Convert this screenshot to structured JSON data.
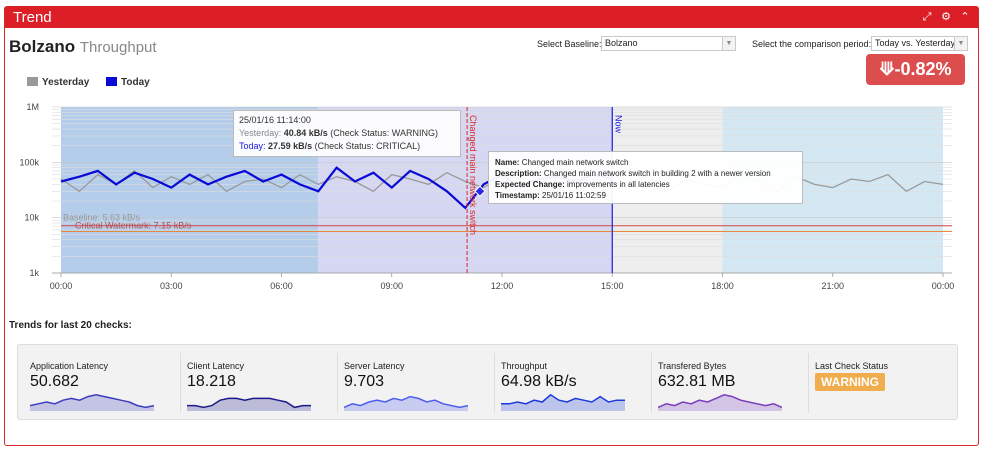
{
  "panel": {
    "title": "Trend"
  },
  "header_icons": [
    "expand-icon",
    "gear-icon",
    "collapse-icon"
  ],
  "page": {
    "title": "Bolzano",
    "subtitle": "Throughput"
  },
  "baseline": {
    "label": "Select Baseline:",
    "value": "Bolzano"
  },
  "comparison": {
    "label": "Select the comparison period:",
    "value": "Today vs. Yesterday"
  },
  "change_badge": {
    "text": "-0.82%",
    "icon": "arrow-down-icon",
    "color": "#dc4d4d"
  },
  "legend": [
    {
      "label": "Yesterday",
      "color": "#999999"
    },
    {
      "label": "Today",
      "color": "#0a0ad6"
    }
  ],
  "annotations": {
    "event_label": "Changed main network switch",
    "now_label": "Now",
    "baseline_label": "Baseline: 5.63 kB/s",
    "critical_label": "Critical Watermark: 7.15 kB/s"
  },
  "tooltip": {
    "time": "25/01/16 11:14:00",
    "yesterday_prefix": "Yesterday:",
    "yesterday_value": "40.84 kB/s",
    "yesterday_status": "(Check Status: WARNING)",
    "today_prefix": "Today:",
    "today_value": "27.59 kB/s",
    "today_status": "(Check Status: CRITICAL)"
  },
  "info_box": {
    "name_label": "Name:",
    "name": "Changed main network switch",
    "desc_label": "Description:",
    "desc": "Changed main network switch in building 2 with a newer version",
    "expected_label": "Expected Change:",
    "expected": "improvements in all latencies",
    "timestamp_label": "Timestamp:",
    "timestamp": "25/01/16 11:02:59"
  },
  "chart_data": {
    "type": "line",
    "yscale": "log",
    "yticks": [
      "1M",
      "100k",
      "10k",
      "1k"
    ],
    "xticks": [
      "00:00",
      "03:00",
      "06:00",
      "09:00",
      "12:00",
      "15:00",
      "18:00",
      "21:00",
      "00:00"
    ],
    "xlim_hours": [
      0,
      24
    ],
    "ylim_bytes_per_s": [
      1000,
      1000000
    ],
    "baseline_kBps": 5.63,
    "critical_watermark_kBps": 7.15,
    "event_hour": 11.0497,
    "now_hour": 15.0,
    "bands": [
      {
        "from_hour": 0,
        "to_hour": 7,
        "color": "#b4cdea"
      },
      {
        "from_hour": 7,
        "to_hour": 15,
        "color": "#d5d7f3"
      },
      {
        "from_hour": 15,
        "to_hour": 18,
        "color": "#eeeeee"
      },
      {
        "from_hour": 18,
        "to_hour": 24,
        "color": "#d3e8f3"
      }
    ],
    "series": [
      {
        "name": "Yesterday",
        "color": "#999999",
        "x": [
          0,
          0.5,
          1,
          1.5,
          2,
          2.5,
          3,
          3.5,
          4,
          4.5,
          5,
          5.5,
          6,
          6.5,
          7,
          7.5,
          8,
          8.5,
          9,
          9.5,
          10,
          10.5,
          11,
          11.5,
          12,
          12.5,
          13,
          13.5,
          14,
          14.5,
          15,
          15.5,
          16,
          16.5,
          17,
          17.5,
          18,
          18.5,
          19,
          19.5,
          20,
          20.5,
          21,
          21.5,
          22,
          22.5,
          23,
          23.5,
          24
        ],
        "y": [
          50,
          30,
          60,
          40,
          70,
          35,
          55,
          40,
          60,
          30,
          45,
          50,
          35,
          60,
          40,
          55,
          45,
          30,
          60,
          50,
          40,
          65,
          45,
          35,
          55,
          40,
          50,
          30,
          45,
          50,
          35,
          45,
          55,
          30,
          50,
          40,
          35,
          60,
          45,
          30,
          55,
          40,
          35,
          50,
          45,
          60,
          30,
          45,
          40
        ]
      },
      {
        "name": "Today",
        "color": "#0a0ad6",
        "x": [
          0,
          0.5,
          1,
          1.5,
          2,
          2.5,
          3,
          3.5,
          4,
          4.5,
          5,
          5.5,
          6,
          6.5,
          7,
          7.5,
          8,
          8.5,
          9,
          9.5,
          10,
          10.5,
          11,
          11.5,
          12,
          12.5,
          13,
          13.5,
          14,
          14.5,
          15
        ],
        "y": [
          45,
          55,
          70,
          40,
          65,
          50,
          35,
          60,
          40,
          55,
          70,
          45,
          60,
          40,
          30,
          80,
          45,
          65,
          35,
          70,
          50,
          30,
          15,
          40,
          60,
          35,
          50,
          55,
          45,
          60,
          50
        ]
      }
    ]
  },
  "trends_title": "Trends for last 20 checks:",
  "metrics": [
    {
      "label": "Application Latency",
      "value": "50.682",
      "color": "#3d3dbf",
      "spark": [
        3,
        4,
        5,
        4,
        6,
        7,
        6,
        8,
        9,
        8,
        7,
        6,
        5,
        3,
        2,
        3
      ]
    },
    {
      "label": "Client Latency",
      "value": "18.218",
      "color": "#1a1a8c",
      "spark": [
        3,
        3,
        2,
        3,
        6,
        7,
        7,
        6,
        7,
        7,
        7,
        6,
        5,
        2,
        3,
        3
      ]
    },
    {
      "label": "Server Latency",
      "value": "9.703",
      "color": "#4d5df0",
      "spark": [
        2,
        4,
        3,
        5,
        6,
        5,
        7,
        6,
        8,
        7,
        5,
        6,
        4,
        3,
        2,
        3
      ]
    },
    {
      "label": "Throughput",
      "value": "64.98 kB/s",
      "color": "#1a3adb",
      "spark": [
        4,
        4,
        5,
        4,
        6,
        5,
        9,
        6,
        5,
        7,
        6,
        5,
        8,
        5,
        6,
        6
      ]
    },
    {
      "label": "Transfered Bytes",
      "value": "632.81 MB",
      "color": "#7a3dbf",
      "spark": [
        2,
        4,
        3,
        5,
        4,
        6,
        5,
        7,
        9,
        8,
        6,
        5,
        4,
        3,
        4,
        2
      ]
    },
    {
      "label": "Last Check Status",
      "badge": "WARNING",
      "badge_color": "#f0ad4e"
    }
  ]
}
